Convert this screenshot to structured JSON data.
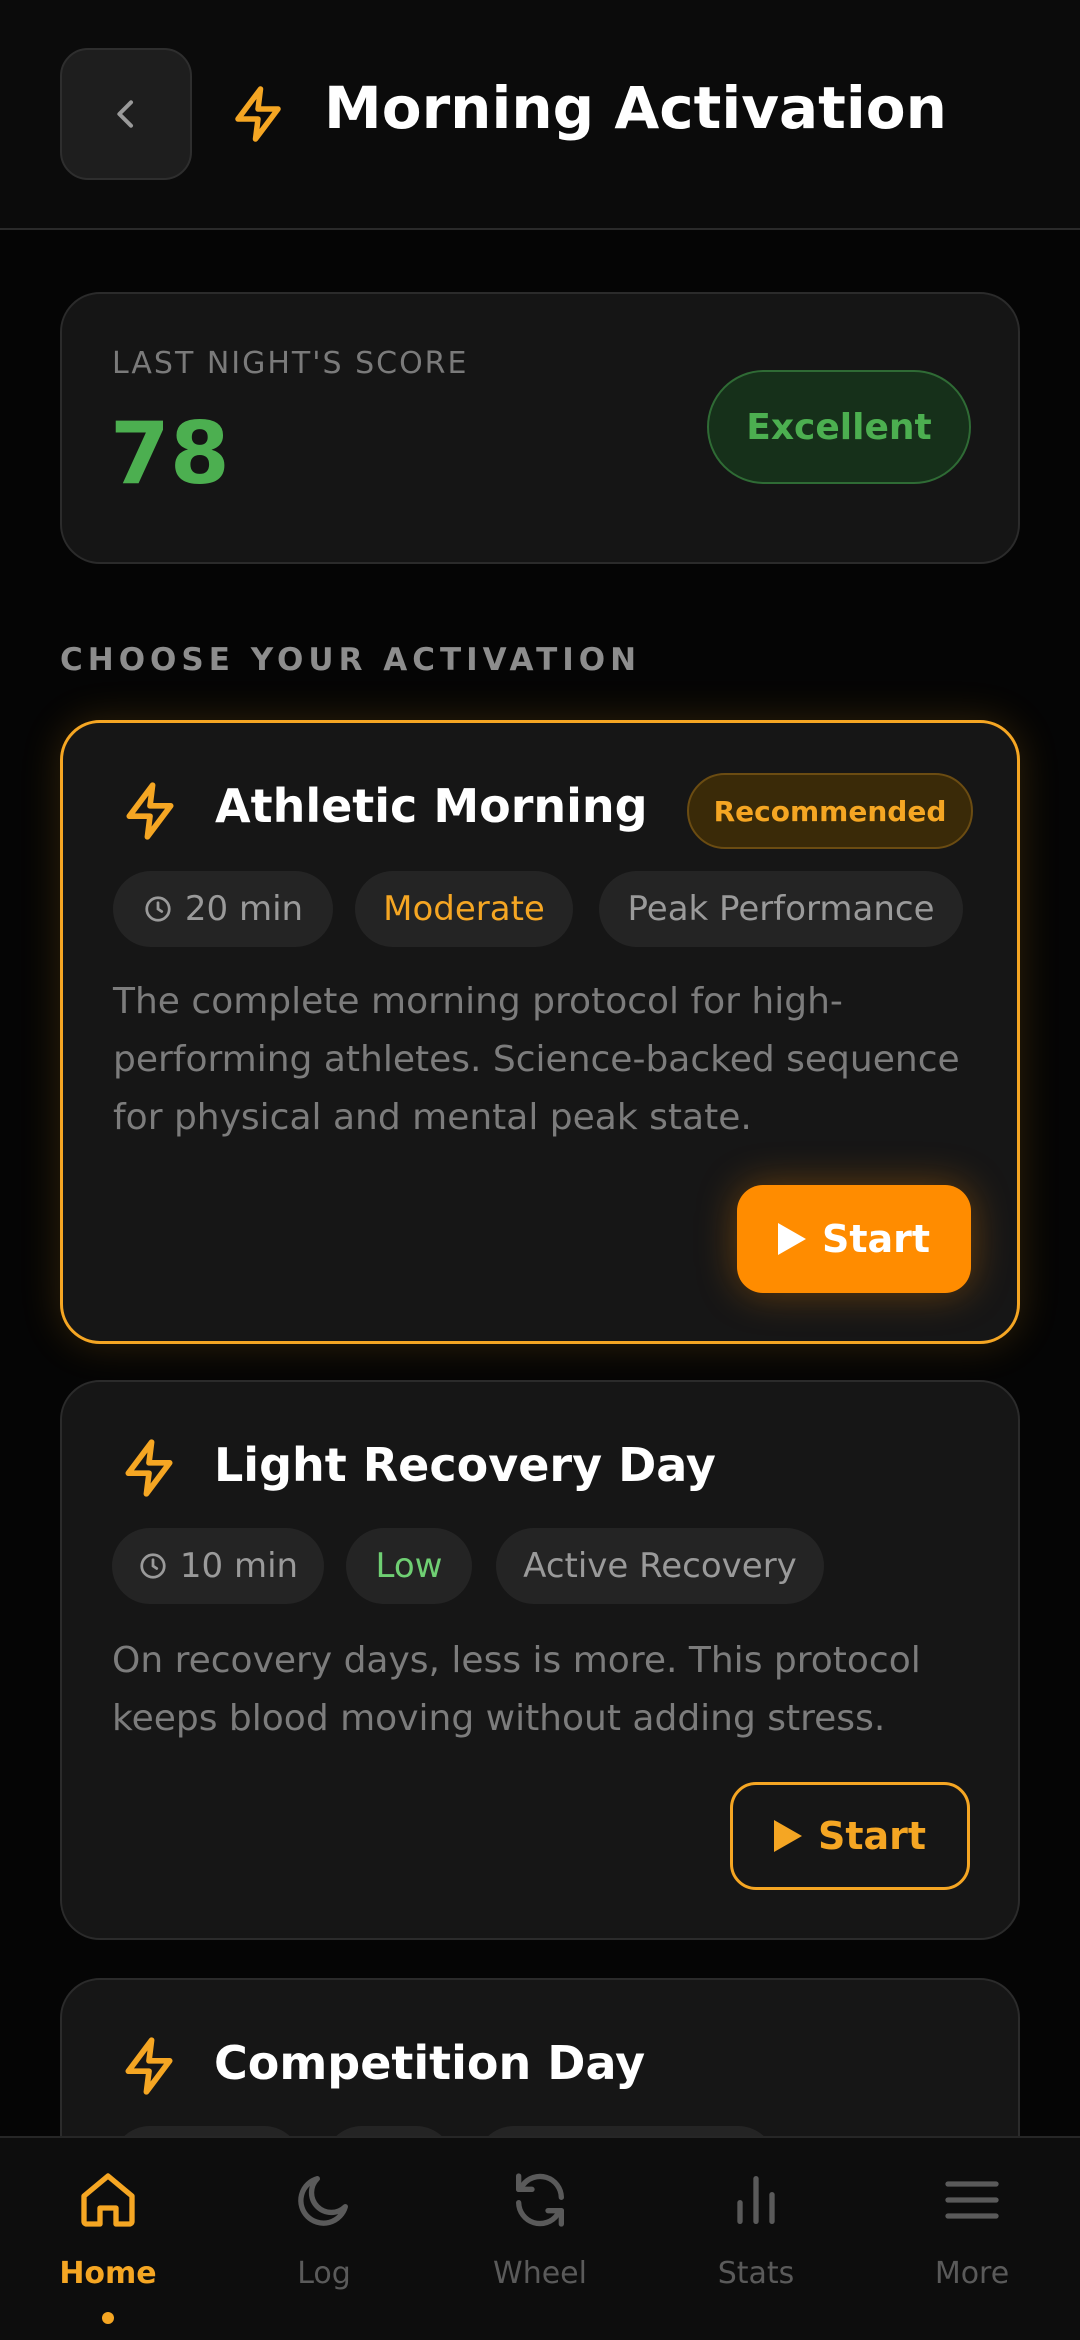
{
  "header": {
    "title": "Morning Activation"
  },
  "score": {
    "label": "LAST NIGHT'S SCORE",
    "value": "78",
    "badge": "Excellent"
  },
  "section_title": "CHOOSE YOUR ACTIVATION",
  "activations": [
    {
      "title": "Athletic Morning",
      "badge": "Recommended",
      "duration": "20 min",
      "intensity": "Moderate",
      "category": "Peak Performance",
      "description": "The complete morning protocol for high-performing athletes. Science-backed sequence for physical and mental peak state.",
      "start_label": "Start"
    },
    {
      "title": "Light Recovery Day",
      "duration": "10 min",
      "intensity": "Low",
      "category": "Active Recovery",
      "description": "On recovery days, less is more. This protocol keeps blood moving without adding stress.",
      "start_label": "Start"
    },
    {
      "title": "Competition Day"
    }
  ],
  "nav": {
    "items": [
      {
        "label": "Home",
        "icon": "home-icon",
        "active": true
      },
      {
        "label": "Log",
        "icon": "moon-icon"
      },
      {
        "label": "Wheel",
        "icon": "refresh-icon"
      },
      {
        "label": "Stats",
        "icon": "bar-chart-icon"
      },
      {
        "label": "More",
        "icon": "menu-icon"
      }
    ]
  },
  "colors": {
    "accent": "#f5a623",
    "orange": "#ff8c00",
    "good": "#4caf50",
    "background": "#050505",
    "card": "#161616"
  }
}
